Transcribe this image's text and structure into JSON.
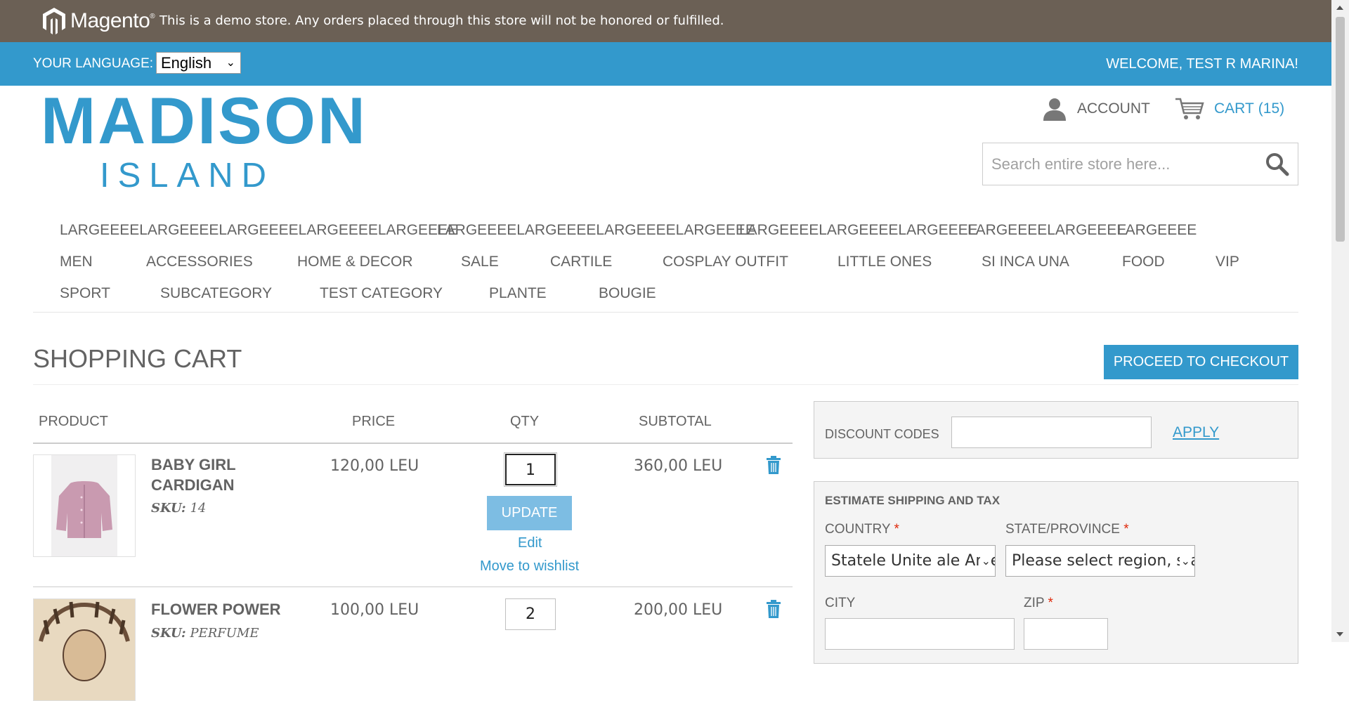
{
  "demo_notice": {
    "logo_text": "Magento",
    "text": "This is a demo store. Any orders placed through this store will not be honored or fulfilled."
  },
  "header": {
    "language_label": "YOUR LANGUAGE:",
    "language_selected": "English",
    "welcome": "WELCOME, TEST R MARINA!",
    "logo_main": "MADISON",
    "logo_sub": "ISLAND",
    "account_label": "ACCOUNT",
    "cart_label": "CART",
    "cart_count": "(15)",
    "search_placeholder": "Search entire store here..."
  },
  "nav": {
    "row1": [
      "LARGEEEELARGEEEELARGEEEELARGEEEELARGEEEE",
      "LARGEEEELARGEEEELARGEEEELARGEEEE",
      "LARGEEEELARGEEEELARGEEEE",
      "LARGEEEELARGEEEE",
      "LARGEEEE"
    ],
    "row2": [
      "MEN",
      "ACCESSORIES",
      "HOME & DECOR",
      "SALE",
      "CARTILE",
      "COSPLAY OUTFIT",
      "LITTLE ONES",
      "SI INCA UNA",
      "FOOD",
      "VIP"
    ],
    "row3": [
      "SPORT",
      "SUBCATEGORY",
      "TEST CATEGORY",
      "PLANTE",
      "BOUGIE"
    ]
  },
  "page": {
    "title": "SHOPPING CART",
    "checkout_button": "PROCEED TO CHECKOUT"
  },
  "cart_table": {
    "headers": [
      "PRODUCT",
      "PRICE",
      "QTY",
      "SUBTOTAL"
    ],
    "items": [
      {
        "name": "BABY GIRL CARDIGAN",
        "sku_label": "SKU:",
        "sku": "14",
        "price": "120,00 LEU",
        "qty": "1",
        "subtotal": "360,00 LEU",
        "update_label": "UPDATE",
        "edit_label": "Edit",
        "wishlist_label": "Move to wishlist"
      },
      {
        "name": "FLOWER POWER",
        "sku_label": "SKU:",
        "sku": "PERFUME",
        "price": "100,00 LEU",
        "qty": "2",
        "subtotal": "200,00 LEU"
      }
    ]
  },
  "discount": {
    "label": "DISCOUNT CODES",
    "value": "",
    "apply_label": "APPLY"
  },
  "shipping": {
    "title": "ESTIMATE SHIPPING AND TAX",
    "country_label": "COUNTRY",
    "country_value": "Statele Unite ale Americii",
    "state_label": "STATE/PROVINCE",
    "state_value": "Please select region, state or province",
    "city_label": "CITY",
    "zip_label": "ZIP",
    "required_mark": "*"
  },
  "colors": {
    "demo_bar": "#6b6055",
    "brand_blue": "#3399cc",
    "text_gray": "#636363",
    "required": "#df280a"
  }
}
